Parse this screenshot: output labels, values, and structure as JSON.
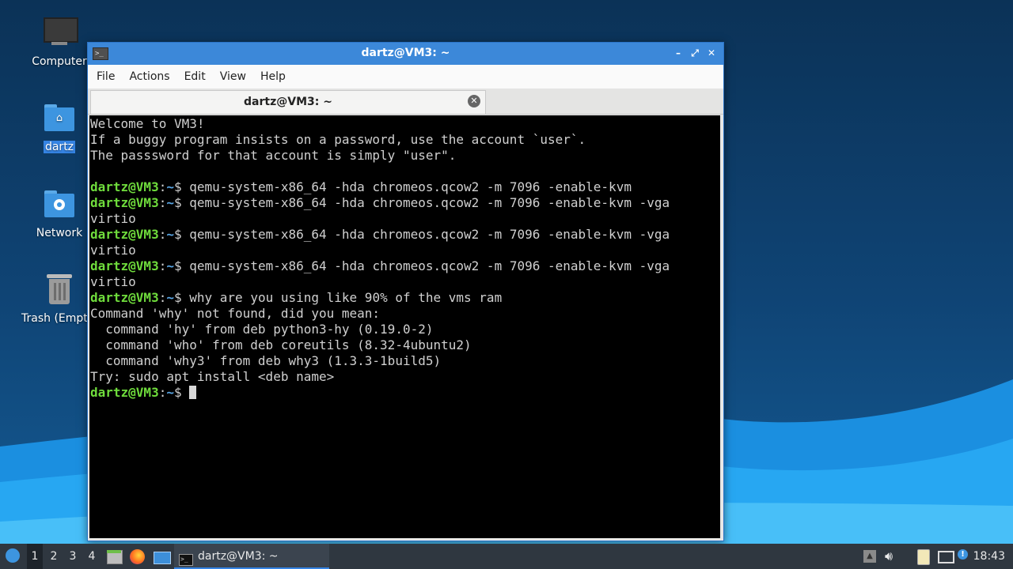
{
  "desktop": {
    "icons": [
      {
        "label": "Computer",
        "icon": "computer-icon"
      },
      {
        "label": "dartz",
        "icon": "home-folder-icon"
      },
      {
        "label": "Network",
        "icon": "network-folder-icon"
      },
      {
        "label": "Trash (Empty)",
        "icon": "trash-icon"
      }
    ]
  },
  "window": {
    "title": "dartz@VM3: ~",
    "menu": [
      "File",
      "Actions",
      "Edit",
      "View",
      "Help"
    ],
    "tab_title": "dartz@VM3: ~",
    "prompt": {
      "user": "dartz@VM3",
      "sep": ":",
      "path": "~",
      "sym": "$ "
    },
    "terminal": {
      "lines": [
        {
          "type": "out",
          "text": "Welcome to VM3!"
        },
        {
          "type": "out",
          "text": "If a buggy program insists on a password, use the account `user`."
        },
        {
          "type": "out",
          "text": "The passsword for that account is simply \"user\"."
        },
        {
          "type": "out",
          "text": ""
        },
        {
          "type": "cmd",
          "text": "qemu-system-x86_64 -hda chromeos.qcow2 -m 7096 -enable-kvm"
        },
        {
          "type": "cmd",
          "text": "qemu-system-x86_64 -hda chromeos.qcow2 -m 7096 -enable-kvm -vga"
        },
        {
          "type": "out",
          "text": "virtio"
        },
        {
          "type": "cmd",
          "text": "qemu-system-x86_64 -hda chromeos.qcow2 -m 7096 -enable-kvm -vga"
        },
        {
          "type": "out",
          "text": "virtio"
        },
        {
          "type": "cmd",
          "text": "qemu-system-x86_64 -hda chromeos.qcow2 -m 7096 -enable-kvm -vga"
        },
        {
          "type": "out",
          "text": "virtio"
        },
        {
          "type": "cmd",
          "text": "why are you using like 90% of the vms ram"
        },
        {
          "type": "out",
          "text": "Command 'why' not found, did you mean:"
        },
        {
          "type": "out",
          "text": "  command 'hy' from deb python3-hy (0.19.0-2)"
        },
        {
          "type": "out",
          "text": "  command 'who' from deb coreutils (8.32-4ubuntu2)"
        },
        {
          "type": "out",
          "text": "  command 'why3' from deb why3 (1.3.3-1build5)"
        },
        {
          "type": "out",
          "text": "Try: sudo apt install <deb name>"
        },
        {
          "type": "cmd",
          "text": "",
          "cursor": true
        }
      ]
    }
  },
  "taskbar": {
    "workspaces": [
      "1",
      "2",
      "3",
      "4"
    ],
    "active_workspace": "1",
    "launchers": [
      "file-manager-icon",
      "firefox-icon",
      "show-desktop-icon"
    ],
    "task_label": "dartz@VM3: ~",
    "tray": [
      "tray-up-arrow-icon",
      "volume-icon",
      "clipboard-icon",
      "network-icon",
      "notification-icon"
    ],
    "clock": "18:43"
  },
  "colors": {
    "accent": "#3c88d9",
    "prompt_user": "#6fdc3c",
    "prompt_path": "#5aa7e6",
    "terminal_bg": "#000000"
  }
}
